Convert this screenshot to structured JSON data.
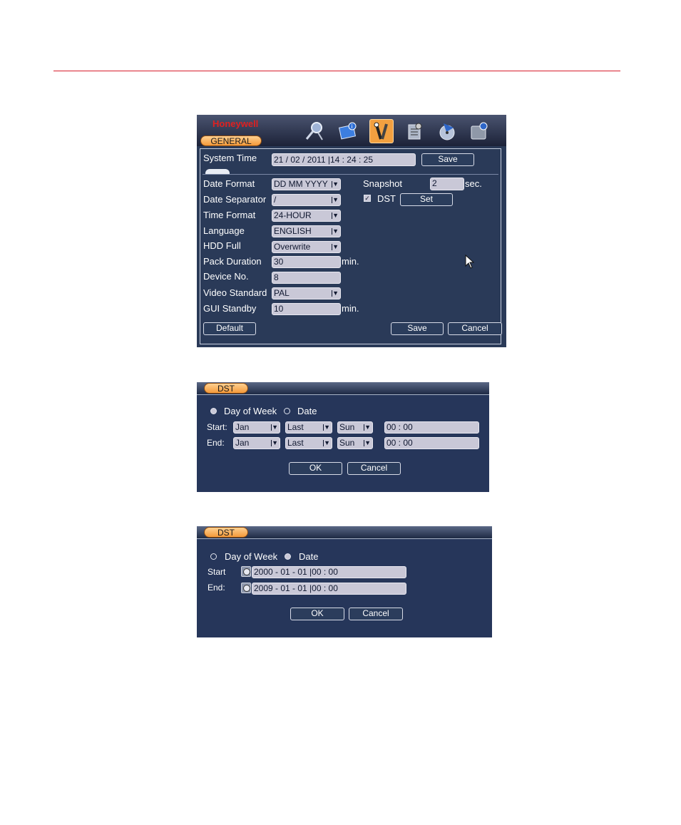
{
  "general": {
    "brand": "Honeywell",
    "tab": "GENERAL",
    "toolbar_icons": [
      "search-camera-icon",
      "info-book-icon",
      "tools-icon",
      "advanced-icon",
      "backup-icon",
      "shutdown-icon"
    ],
    "system_time_label": "System Time",
    "system_time_value": "21 / 02 / 2011  |14 : 24 : 25",
    "save_top": "Save",
    "fields": {
      "date_format_label": "Date Format",
      "date_format_value": "DD MM YYYY",
      "date_separator_label": "Date Separator",
      "date_separator_value": "/",
      "time_format_label": "Time Format",
      "time_format_value": "24-HOUR",
      "language_label": "Language",
      "language_value": "ENGLISH",
      "hdd_full_label": "HDD Full",
      "hdd_full_value": "Overwrite",
      "pack_duration_label": "Pack Duration",
      "pack_duration_value": "30",
      "pack_duration_unit": "min.",
      "device_no_label": "Device No.",
      "device_no_value": "8",
      "video_standard_label": "Video Standard",
      "video_standard_value": "PAL",
      "gui_standby_label": "GUI Standby",
      "gui_standby_value": "10",
      "gui_standby_unit": "min."
    },
    "snapshot_label": "Snapshot",
    "snapshot_value": "2",
    "snapshot_unit": "sec.",
    "dst_label": "DST",
    "dst_checked": true,
    "set_button": "Set",
    "default_button": "Default",
    "save_button": "Save",
    "cancel_button": "Cancel"
  },
  "dst_week": {
    "title": "DST",
    "mode_week": "Day of Week",
    "mode_date": "Date",
    "selected": "week",
    "start_label": "Start:",
    "end_label": "End:",
    "start": {
      "month": "Jan",
      "week": "Last",
      "day": "Sun",
      "time": "00  :  00"
    },
    "end": {
      "month": "Jan",
      "week": "Last",
      "day": "Sun",
      "time": "00  :  00"
    },
    "ok": "OK",
    "cancel": "Cancel"
  },
  "dst_date": {
    "title": "DST",
    "mode_week": "Day of Week",
    "mode_date": "Date",
    "selected": "date",
    "start_label": "Start",
    "end_label": "End:",
    "start_value": "2000  - 01 - 01  |00 :  00",
    "end_value": "2009  - 01 - 01  |00 :  00",
    "ok": "OK",
    "cancel": "Cancel"
  },
  "colors": {
    "rule": "#d81e2c",
    "panel": "#2b3d5c",
    "tab": "#f49a3a",
    "field": "#c9c8d7"
  }
}
